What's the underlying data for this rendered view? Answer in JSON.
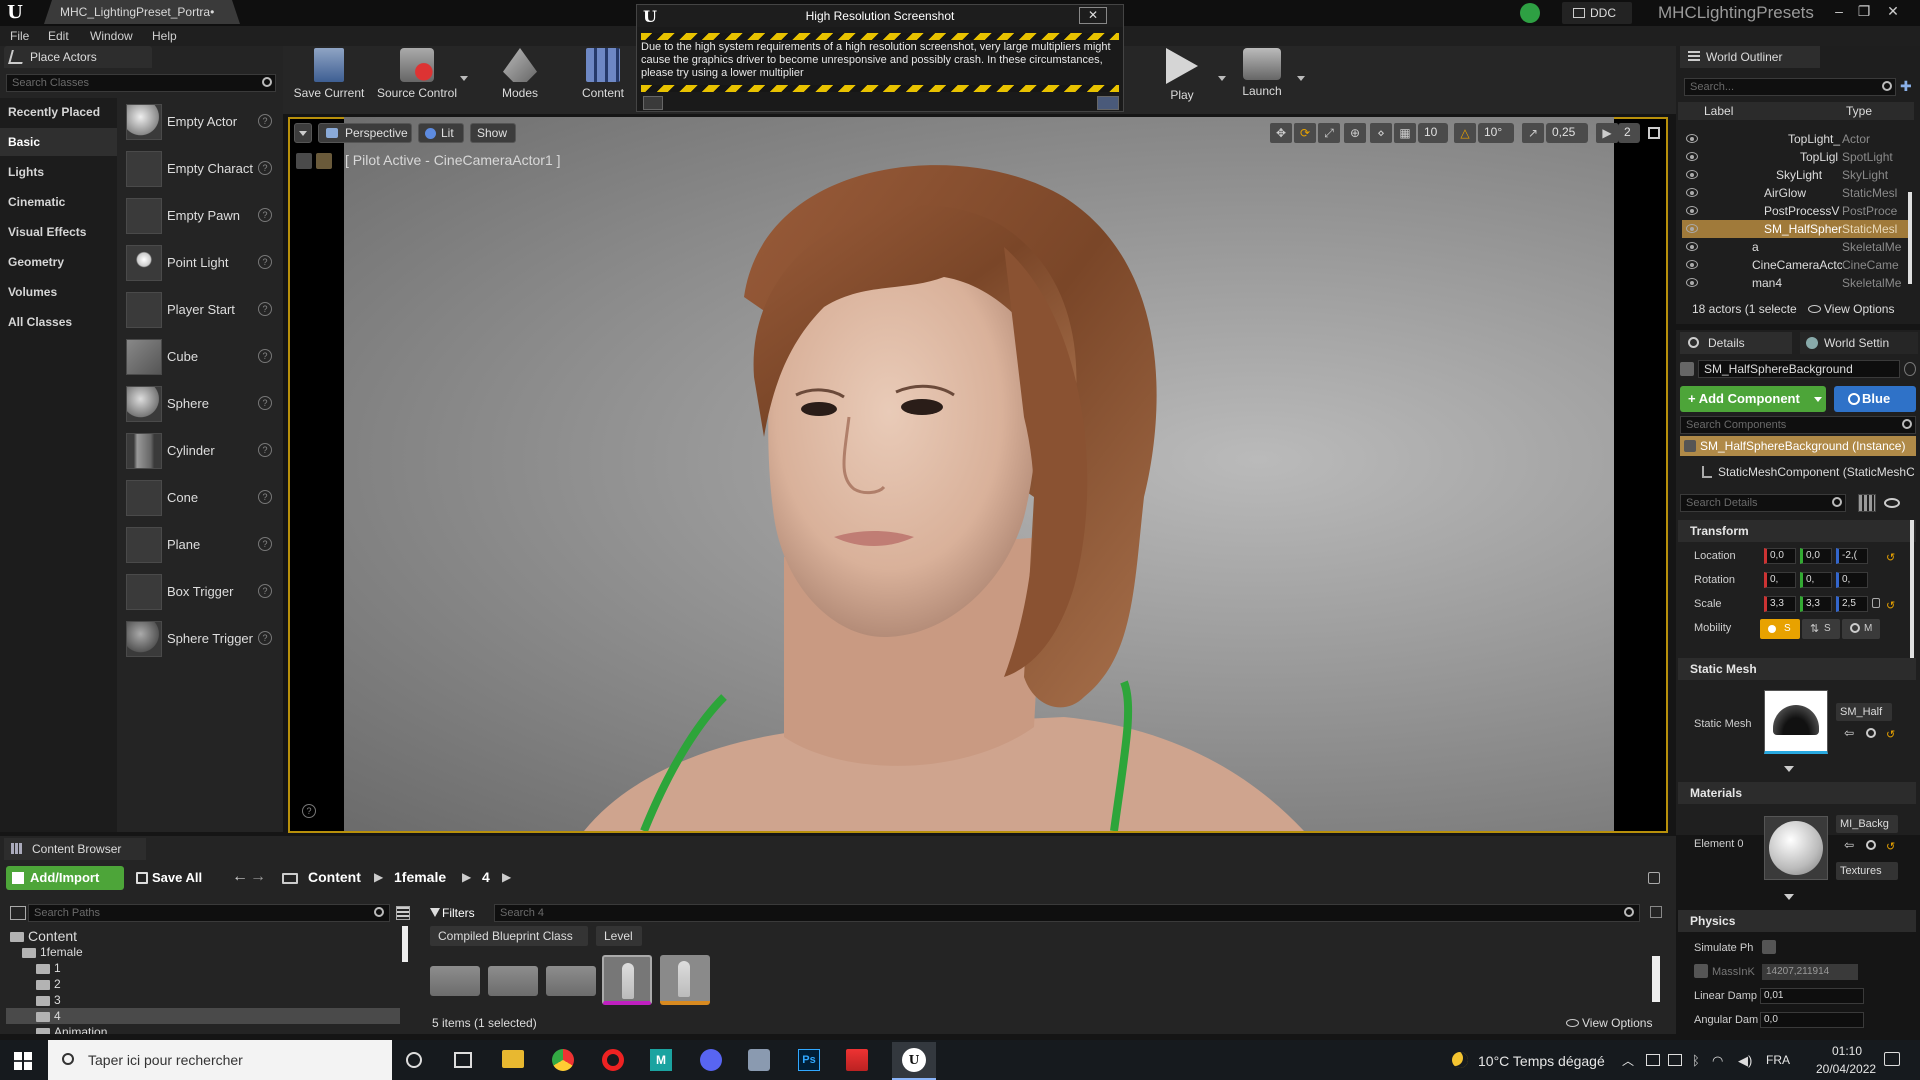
{
  "window": {
    "tab_title": "MHC_LightingPreset_Portra•",
    "ddc_label": "DDC",
    "project_name": "MHCLightingPresets"
  },
  "menu": [
    "File",
    "Edit",
    "Window",
    "Help"
  ],
  "popup": {
    "title": "High Resolution Screenshot",
    "message": "Due to the high system requirements of a high resolution screenshot, very large multipliers might cause the graphics driver to become unresponsive and possibly crash. In these circumstances, please try using a lower multiplier"
  },
  "place_actors": {
    "tab": "Place Actors",
    "search_placeholder": "Search Classes",
    "categories": [
      "Recently Placed",
      "Basic",
      "Lights",
      "Cinematic",
      "Visual Effects",
      "Geometry",
      "Volumes",
      "All Classes"
    ],
    "actors": [
      "Empty Actor",
      "Empty Charact",
      "Empty Pawn",
      "Point Light",
      "Player Start",
      "Cube",
      "Sphere",
      "Cylinder",
      "Cone",
      "Plane",
      "Box Trigger",
      "Sphere Trigger"
    ]
  },
  "toolbar": {
    "save_current": "Save Current",
    "source_control": "Source Control",
    "modes": "Modes",
    "content": "Content",
    "play": "Play",
    "launch": "Launch"
  },
  "viewport": {
    "perspective": "Perspective",
    "lit": "Lit",
    "show": "Show",
    "pilot_text": "[ Pilot Active - CineCameraActor1 ]",
    "grid_snap": "10",
    "rot_snap": "10°",
    "scale_snap": "0,25",
    "cam_speed": "2"
  },
  "outliner": {
    "tab": "World Outliner",
    "search_placeholder": "Search...",
    "col_label": "Label",
    "col_type": "Type",
    "rows": [
      {
        "name": "TopLight_",
        "type": "Actor"
      },
      {
        "name": "TopLigl",
        "type": "SpotLight"
      },
      {
        "name": "SkyLight",
        "type": "SkyLight"
      },
      {
        "name": "AirGlow",
        "type": "StaticMesl"
      },
      {
        "name": "PostProcessV",
        "type": "PostProce"
      },
      {
        "name": "SM_HalfSpher",
        "type": "StaticMesl"
      },
      {
        "name": "a",
        "type": "SkeletalMe"
      },
      {
        "name": "CineCameraActc",
        "type": "CineCame"
      },
      {
        "name": "man4",
        "type": "SkeletalMe"
      }
    ],
    "footer": "18 actors (1 selecte",
    "view_options": "View Options"
  },
  "details": {
    "tab": "Details",
    "tab2": "World Settin",
    "object_name": "SM_HalfSphereBackground",
    "add_component": "+ Add Component",
    "blueprint": "Blue",
    "search_components": "Search Components",
    "instance": "SM_HalfSphereBackground (Instance)",
    "component": "StaticMeshComponent (StaticMeshC",
    "search_details": "Search Details",
    "transform": {
      "title": "Transform",
      "location_label": "Location",
      "location": [
        "0,0",
        "0,0",
        "-2,("
      ],
      "rotation_label": "Rotation",
      "rotation": [
        "0,",
        "0,",
        "0,"
      ],
      "scale_label": "Scale",
      "scale": [
        "3,3",
        "3,3",
        "2,5"
      ],
      "mobility_label": "Mobility",
      "mobility": [
        "S",
        "S",
        "M"
      ]
    },
    "static_mesh": {
      "title": "Static Mesh",
      "label": "Static Mesh",
      "value": "SM_Half"
    },
    "materials": {
      "title": "Materials",
      "label": "Element 0",
      "value": "MI_Backg",
      "textures": "Textures"
    },
    "physics": {
      "title": "Physics",
      "simulate": "Simulate Ph",
      "mass_label": "MassInK",
      "mass": "14207,211914",
      "linear_label": "Linear Damp",
      "linear": "0,01",
      "angular_label": "Angular Dam",
      "angular": "0,0"
    }
  },
  "content_browser": {
    "tab": "Content Browser",
    "add_import": "Add/Import",
    "save_all": "Save All",
    "path": [
      "Content",
      "1female",
      "4"
    ],
    "search_paths": "Search Paths",
    "filters": "Filters",
    "search_placeholder": "Search 4",
    "chip1": "Compiled Blueprint Class",
    "chip2": "Level",
    "tree": [
      "Content",
      "1female",
      "1",
      "2",
      "3",
      "4",
      "Animation"
    ],
    "status": "5 items (1 selected)",
    "view_options": "View Options"
  },
  "taskbar": {
    "search": "Taper ici pour rechercher",
    "weather": "10°C  Temps dégagé",
    "lang": "FRA",
    "time": "01:10",
    "date": "20/04/2022"
  }
}
